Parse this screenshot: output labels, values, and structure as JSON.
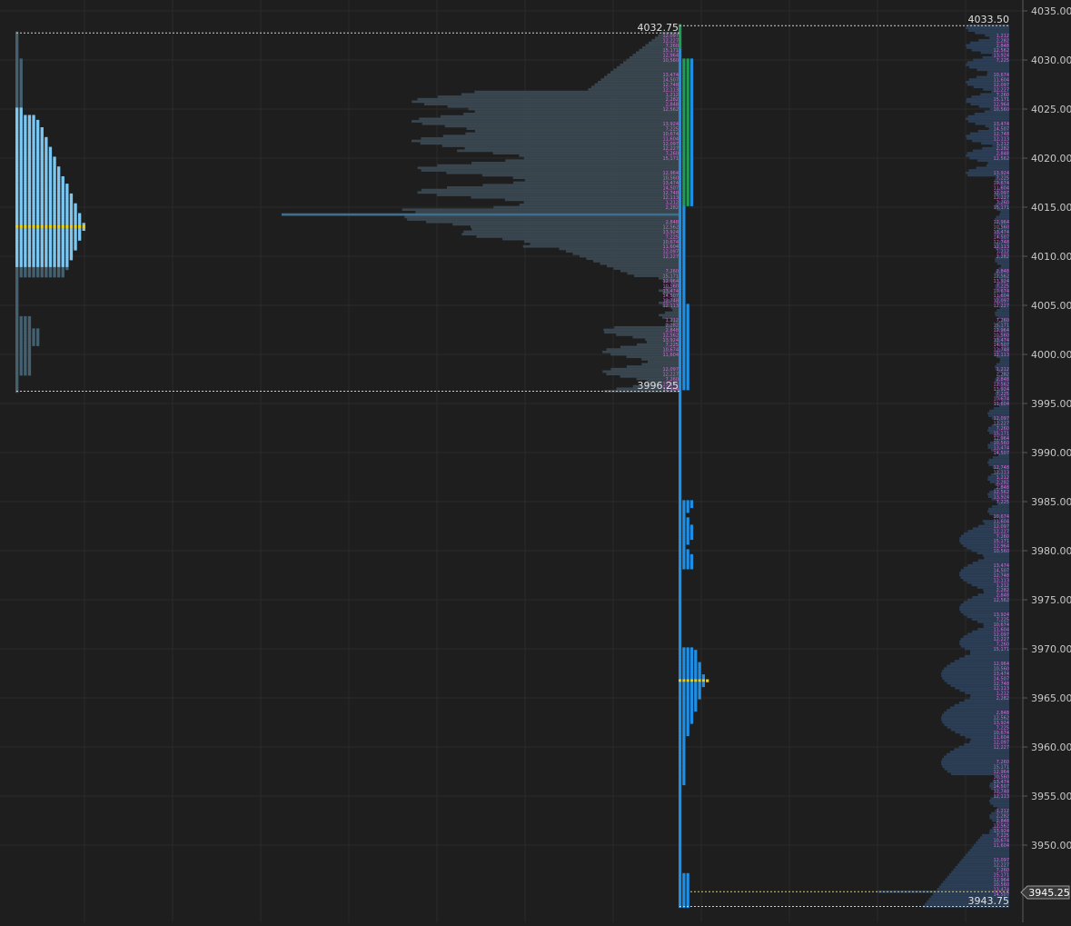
{
  "chart_data": {
    "type": "market-profile",
    "price_axis": {
      "tick_step": 5,
      "ticks": [
        "4035.00",
        "4030.00",
        "4025.00",
        "4020.00",
        "4015.00",
        "4010.00",
        "4005.00",
        "4000.00",
        "3995.00",
        "3990.00",
        "3985.00",
        "3980.00",
        "3975.00",
        "3970.00",
        "3965.00",
        "3960.00",
        "3955.00",
        "3950.00"
      ],
      "range": [
        3943,
        4036
      ],
      "current_price": "3945.25"
    },
    "profile_1": {
      "high_label": "4032.75",
      "low_label": "3996.25",
      "high": 4032.75,
      "low": 3996.25,
      "poc": 4013.0
    },
    "profile_2": {
      "high_label": "4033.50",
      "low_label": "3943.75",
      "high": 4033.5,
      "low": 3943.75,
      "poc": 3966.75
    },
    "colors": {
      "background": "#1e1e1e",
      "grid": "#2a2a2a",
      "tpo_light": "#7cc7f2",
      "tpo_faded": "#44606f",
      "tpo_blue": "#1f8fe6",
      "tpo_green": "#1f9d55",
      "poc": "#f5d000",
      "volume_gray": "#3a464f",
      "volume_blue": "#2b3e55",
      "volume_poc": "#3f6f8f",
      "volume_labels": "#d36ad9",
      "axis_text": "#c8c8c8"
    }
  }
}
